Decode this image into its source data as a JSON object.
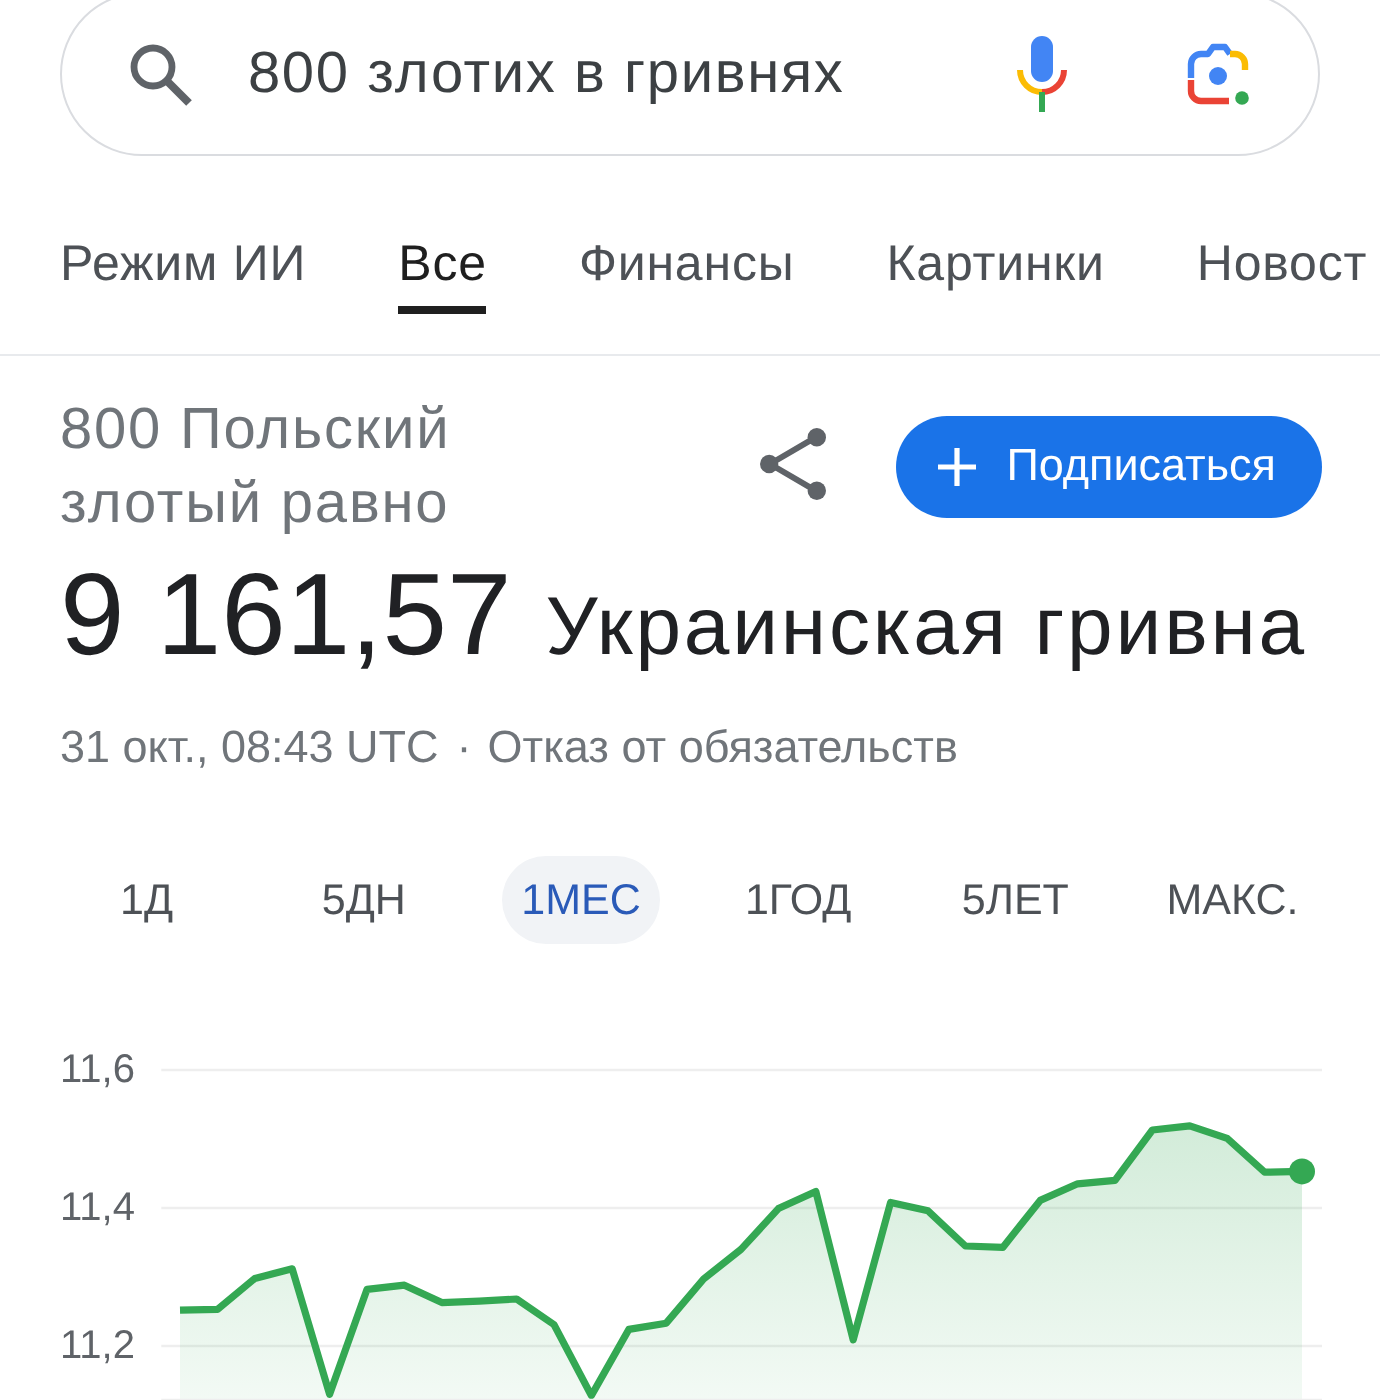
{
  "search_bar": {
    "query": "800 злотих в гривнях"
  },
  "tabs": [
    {
      "label": "Режим ИИ",
      "selected": false
    },
    {
      "label": "Все",
      "selected": true
    },
    {
      "label": "Финансы",
      "selected": false
    },
    {
      "label": "Картинки",
      "selected": false
    },
    {
      "label": "Новост",
      "selected": false
    }
  ],
  "conversion": {
    "source": "800 Польский злотый равно",
    "subscribe_label": "Подписаться",
    "result_value": "9 161,57",
    "result_currency": "Украинская гривна",
    "timestamp": "31 окт., 08:43 UTC",
    "separator": "·",
    "disclaimer": "Отказ от обязательств"
  },
  "ranges": [
    {
      "label": "1Д",
      "selected": false
    },
    {
      "label": "5ДН",
      "selected": false
    },
    {
      "label": "1МЕС",
      "selected": true
    },
    {
      "label": "1ГОД",
      "selected": false
    },
    {
      "label": "5ЛЕТ",
      "selected": false
    },
    {
      "label": "МАКС.",
      "selected": false
    }
  ],
  "chart": {
    "chart_data": {
      "type": "area",
      "grid": true,
      "ylim": [
        11.12,
        11.6
      ],
      "yticks": [
        {
          "value": 11.6,
          "label": "11,6"
        },
        {
          "value": 11.4,
          "label": "11,4"
        },
        {
          "value": 11.2,
          "label": "11,2"
        }
      ],
      "series": [
        {
          "color": "#34a853",
          "values": [
            11.252,
            11.253,
            11.298,
            11.312,
            11.13,
            11.282,
            11.288,
            11.263,
            11.265,
            11.268,
            11.231,
            11.128,
            11.224,
            11.233,
            11.297,
            11.34,
            11.399,
            11.424,
            11.209,
            11.408,
            11.396,
            11.345,
            11.343,
            11.411,
            11.435,
            11.44,
            11.513,
            11.519,
            11.501,
            11.452,
            11.453
          ]
        }
      ]
    }
  }
}
